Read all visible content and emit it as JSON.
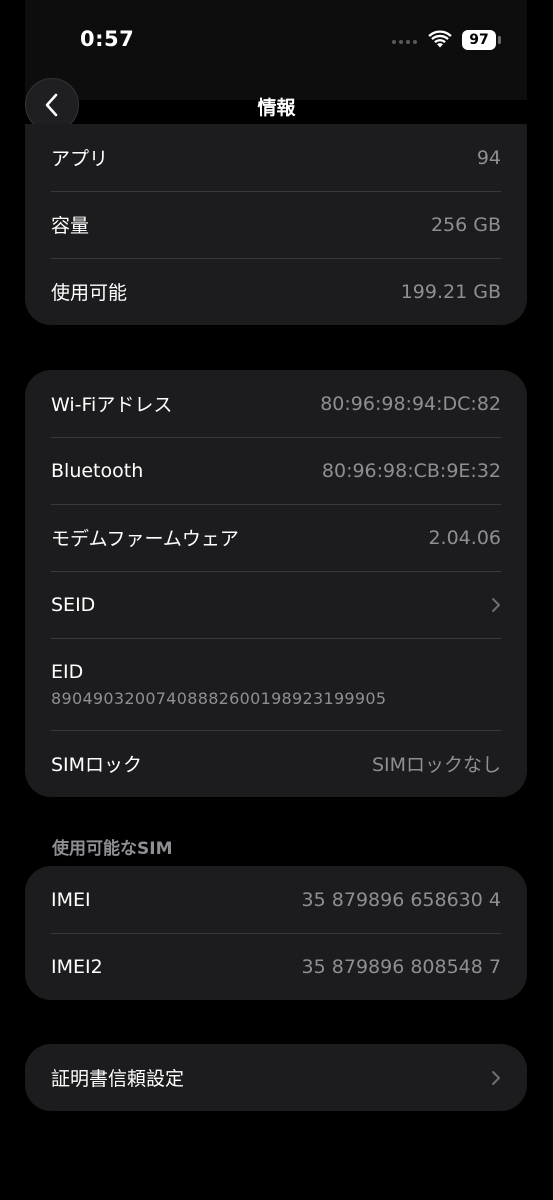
{
  "status_bar": {
    "time": "0:57",
    "battery": "97"
  },
  "nav": {
    "title": "情報"
  },
  "storage_section": [
    {
      "label": "アプリ",
      "value": "94"
    },
    {
      "label": "容量",
      "value": "256 GB"
    },
    {
      "label": "使用可能",
      "value": "199.21 GB"
    }
  ],
  "network_section": {
    "wifi": {
      "label": "Wi-Fiアドレス",
      "value": "80:96:98:94:DC:82"
    },
    "bluetooth": {
      "label": "Bluetooth",
      "value": "80:96:98:CB:9E:32"
    },
    "modem": {
      "label": "モデムファームウェア",
      "value": "2.04.06"
    },
    "seid": {
      "label": "SEID"
    },
    "eid": {
      "label": "EID",
      "value": "89049032007408882600198923199905"
    },
    "sim_lock": {
      "label": "SIMロック",
      "value": "SIMロックなし"
    }
  },
  "sim_section": {
    "header": "使用可能なSIM",
    "imei": {
      "label": "IMEI",
      "value": "35 879896 658630 4"
    },
    "imei2": {
      "label": "IMEI2",
      "value": "35 879896 808548 7"
    }
  },
  "cert_section": {
    "label": "証明書信頼設定"
  },
  "colors": {
    "background": "#000000",
    "card": "#1c1c1e",
    "secondary_text": "#8e8e93",
    "separator": "#38383a"
  }
}
